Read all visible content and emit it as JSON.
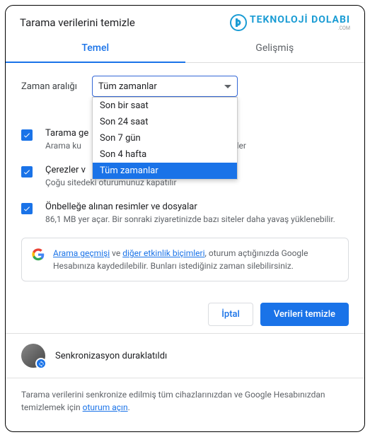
{
  "title": "Tarama verilerini temizle",
  "logo": {
    "main": "TEKNOLOJİ DOLABI",
    "sub": ".COM"
  },
  "tabs": {
    "basic": "Temel",
    "advanced": "Gelişmiş"
  },
  "timerange": {
    "label": "Zaman aralığı",
    "selected": "Tüm zamanlar",
    "options": [
      "Son bir saat",
      "Son 24 saat",
      "Son 7 gün",
      "Son 4 hafta",
      "Tüm zamanlar"
    ]
  },
  "options": {
    "history": {
      "title": "Tarama ge",
      "desc_prefix": "Arama ku",
      "desc_suffix": "temizler"
    },
    "cookies": {
      "title": "Çerezler v",
      "desc": "Çoğu sitedeki oturumunuz kapatılır"
    },
    "cache": {
      "title": "Önbelleğe alınan resimler ve dosyalar",
      "desc": "86,1 MB yer açar. Bir sonraki ziyaretinizde bazı siteler daha yavaş yüklenebilir."
    }
  },
  "info": {
    "link1": "Arama geçmişi",
    "mid1": " ve ",
    "link2": "diğer etkinlik biçimleri",
    "rest": ", oturum açtığınızda Google Hesabınıza kaydedilebilir. Bunları istediğiniz zaman silebilirsiniz."
  },
  "buttons": {
    "cancel": "İptal",
    "confirm": "Verileri temizle"
  },
  "sync": {
    "status": "Senkronizasyon duraklatıldı"
  },
  "footer": {
    "text": "Tarama verilerini senkronize edilmiş tüm cihazlarınızdan ve Google Hesabınızdan temizlemek için ",
    "link": "oturum açın",
    "end": "."
  }
}
